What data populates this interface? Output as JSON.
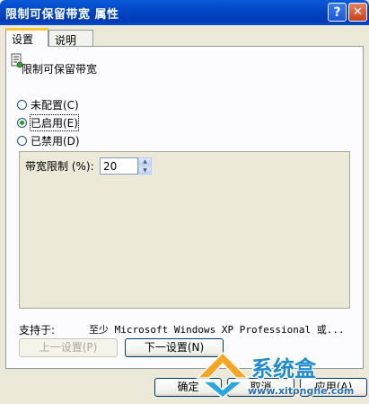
{
  "window": {
    "title": "限制可保留带宽 属性",
    "help_symbol": "?",
    "close_symbol": "✕"
  },
  "tabs": [
    {
      "label": "设置",
      "active": true
    },
    {
      "label": "说明",
      "active": false
    }
  ],
  "policy": {
    "icon": "policy-setting-icon",
    "name": "限制可保留带宽"
  },
  "radios": [
    {
      "label": "未配置(C)",
      "checked": false
    },
    {
      "label": "已启用(E)",
      "checked": true
    },
    {
      "label": "已禁用(D)",
      "checked": false
    }
  ],
  "options": {
    "bandwidth_label": "带宽限制 (%):",
    "bandwidth_value": "20",
    "spin_up": "▲",
    "spin_down": "▼"
  },
  "supported": {
    "label": "支持于:",
    "value": "至少 Microsoft Windows XP Professional 或..."
  },
  "buttons": {
    "prev": "上一设置(P)",
    "next": "下一设置(N)",
    "ok": "确定",
    "cancel": "取消",
    "apply": "应用(A)"
  },
  "watermark": {
    "text": "系统盒",
    "url": "www.xitonghe.com"
  },
  "colors": {
    "titlebar": "#0047c7",
    "window_bg": "#ece9d8",
    "radio_dot": "#21a121",
    "watermark": "#1f8bd1"
  }
}
